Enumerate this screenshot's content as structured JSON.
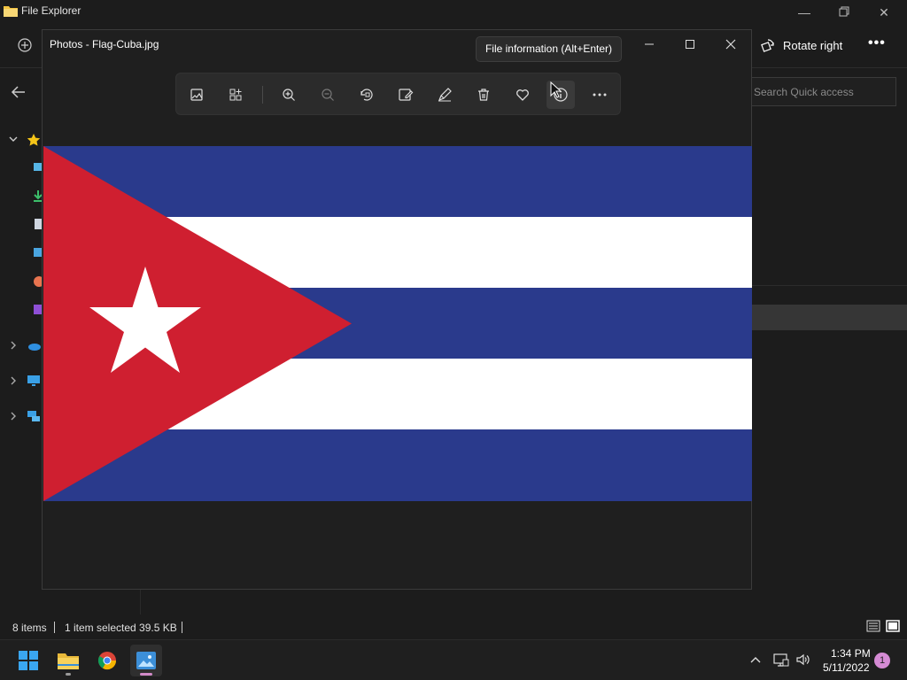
{
  "file_explorer": {
    "title": "File Explorer",
    "rotate_label": "Rotate right",
    "more_label": "•••",
    "search_placeholder": "Search Quick access",
    "status": {
      "item_count": "8 items",
      "selection": "1 item selected  39.5 KB"
    }
  },
  "photos": {
    "window_title": "Photos - Flag-Cuba.jpg",
    "tooltip": "File information (Alt+Enter)",
    "toolbar_icons": [
      "view-image-icon",
      "collection-icon",
      "zoom-in-icon",
      "zoom-out-icon",
      "rotate-icon",
      "edit-image-icon",
      "draw-icon",
      "delete-icon",
      "favorite-icon",
      "file-info-icon",
      "more-icon"
    ]
  },
  "flag": {
    "name": "Flag-Cuba",
    "colors": {
      "blue": "#2a3a8c",
      "white": "#ffffff",
      "red": "#cf1f30"
    }
  },
  "taskbar": {
    "apps": [
      "start-icon",
      "file-explorer-icon",
      "chrome-icon",
      "photos-icon"
    ],
    "time": "1:34 PM",
    "date": "5/11/2022",
    "notifications": "1"
  }
}
